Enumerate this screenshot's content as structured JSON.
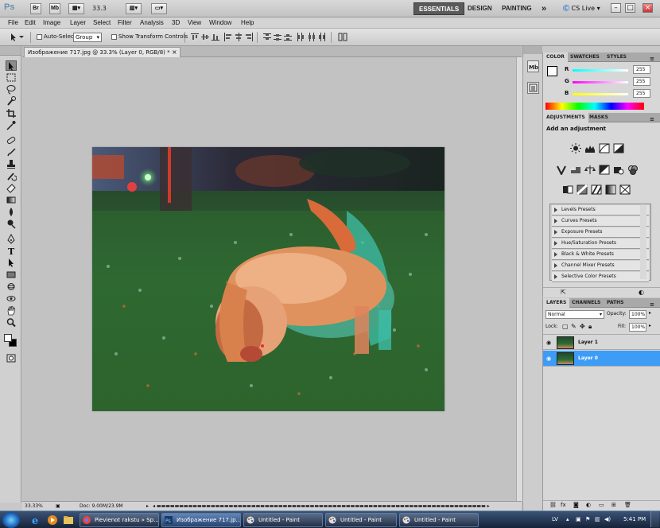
{
  "appbar": {
    "logo": "Ps",
    "bridge_label": "Br",
    "minibridge_label": "Mb",
    "zoom": "33.3",
    "workspaces": [
      "ESSENTIALS",
      "DESIGN",
      "PAINTING"
    ],
    "more_label": "»",
    "cslive_label": "CS Live",
    "minimize": "–",
    "restore": "□",
    "close": "×"
  },
  "menu": [
    "File",
    "Edit",
    "Image",
    "Layer",
    "Select",
    "Filter",
    "Analysis",
    "3D",
    "View",
    "Window",
    "Help"
  ],
  "options": {
    "auto_select_label": "Auto-Select:",
    "auto_select_value": "Group",
    "show_transform_label": "Show Transform Controls"
  },
  "document": {
    "tab_title": "Изображение 717.jpg @ 33.3% (Layer 0, RGB/8) *",
    "close": "×"
  },
  "status": {
    "zoom": "33.33%",
    "doc": "Doc: 9.00M/23.9M"
  },
  "color_panel": {
    "tabs": [
      "COLOR",
      "SWATCHES",
      "STYLES"
    ],
    "channels": [
      {
        "letter": "R",
        "value": "255",
        "color": "#e04040"
      },
      {
        "letter": "G",
        "value": "255",
        "color": "#40c040"
      },
      {
        "letter": "B",
        "value": "255",
        "color": "#4040e0"
      }
    ]
  },
  "adjustments_panel": {
    "tabs": [
      "ADJUSTMENTS",
      "MASKS"
    ],
    "title": "Add an adjustment",
    "presets": [
      "Levels Presets",
      "Curves Presets",
      "Exposure Presets",
      "Hue/Saturation Presets",
      "Black & White Presets",
      "Channel Mixer Presets",
      "Selective Color Presets"
    ]
  },
  "layers_panel": {
    "tabs": [
      "LAYERS",
      "CHANNELS",
      "PATHS"
    ],
    "blend_mode": "Normal",
    "opacity_label": "Opacity:",
    "opacity_value": "100%",
    "lock_label": "Lock:",
    "fill_label": "Fill:",
    "fill_value": "100%",
    "layers": [
      {
        "name": "Layer 1",
        "selected": false
      },
      {
        "name": "Layer 0",
        "selected": true
      }
    ]
  },
  "taskbar": {
    "buttons": [
      {
        "label": "Pievienot rakstu » Sp...",
        "active": false
      },
      {
        "label": "Изображение 717.jp...",
        "active": true
      },
      {
        "label": "Untitled - Paint",
        "active": false
      },
      {
        "label": "Untitled - Paint",
        "active": false
      },
      {
        "label": "Untitled - Paint",
        "active": false
      }
    ],
    "language": "LV",
    "time": "5:41 PM"
  }
}
